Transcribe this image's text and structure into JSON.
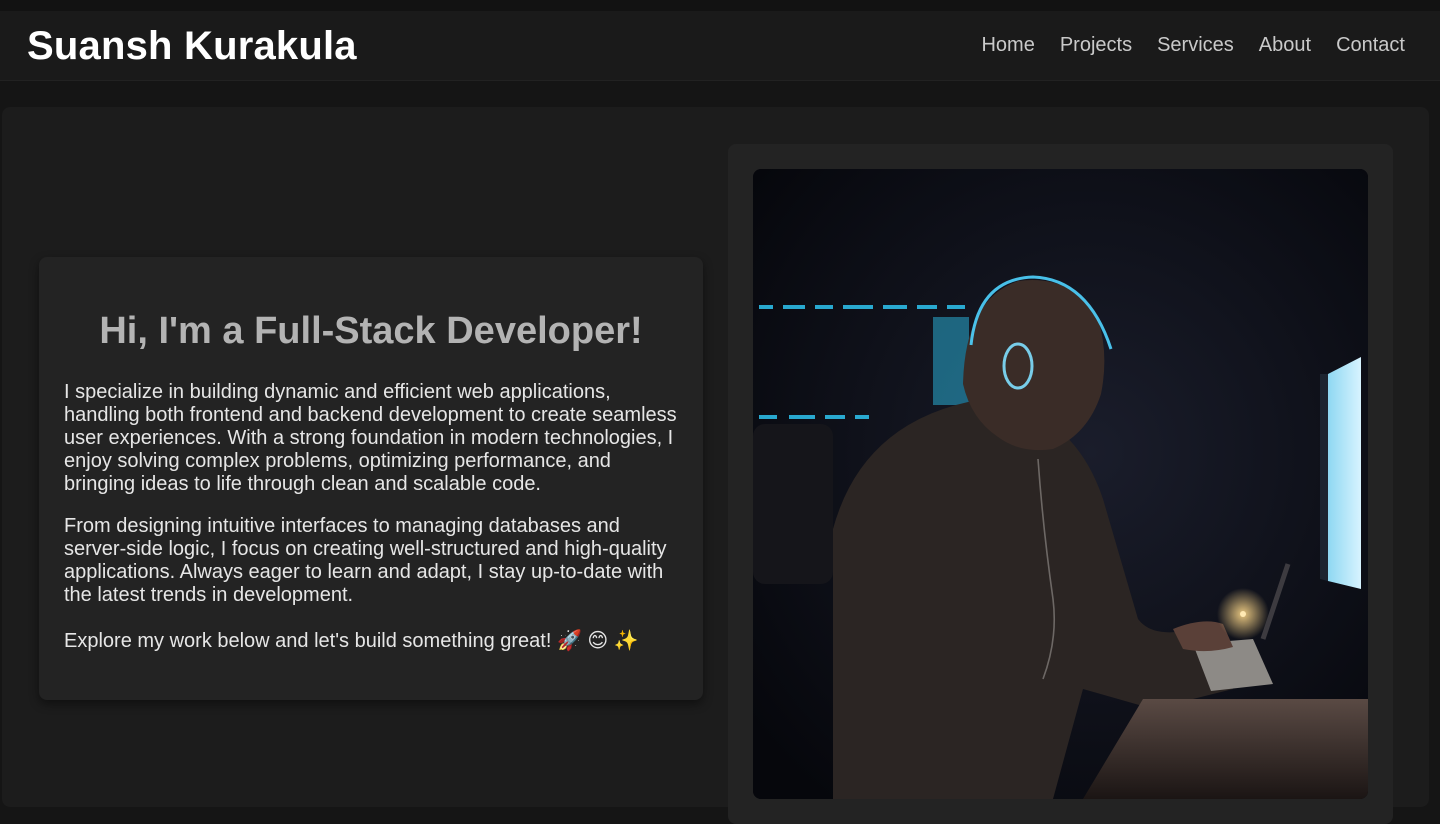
{
  "header": {
    "brand": "Suansh Kurakula",
    "nav": [
      {
        "label": "Home"
      },
      {
        "label": "Projects"
      },
      {
        "label": "Services"
      },
      {
        "label": "About"
      },
      {
        "label": "Contact"
      }
    ]
  },
  "hero": {
    "title": "Hi, I'm a Full-Stack Developer!",
    "paragraphs": [
      "I specialize in building dynamic and efficient web applications, handling both frontend and backend development to create seamless user experiences. With a strong foundation in modern technologies, I enjoy solving complex problems, optimizing performance, and bringing ideas to life through clean and scalable code.",
      "From designing intuitive interfaces to managing databases and server-side logic, I focus on creating well-structured and high-quality applications. Always eager to learn and adapt, I stay up-to-date with the latest trends in development.",
      "Explore my work below and let's build something great! 🚀 😊 ✨"
    ]
  },
  "colors": {
    "background": "#151515",
    "navbar": "#1a1a1a",
    "card": "#232323",
    "title": "#b3b3b3",
    "text": "#e6e6e6",
    "accent_glow": "#4fd3ff"
  }
}
